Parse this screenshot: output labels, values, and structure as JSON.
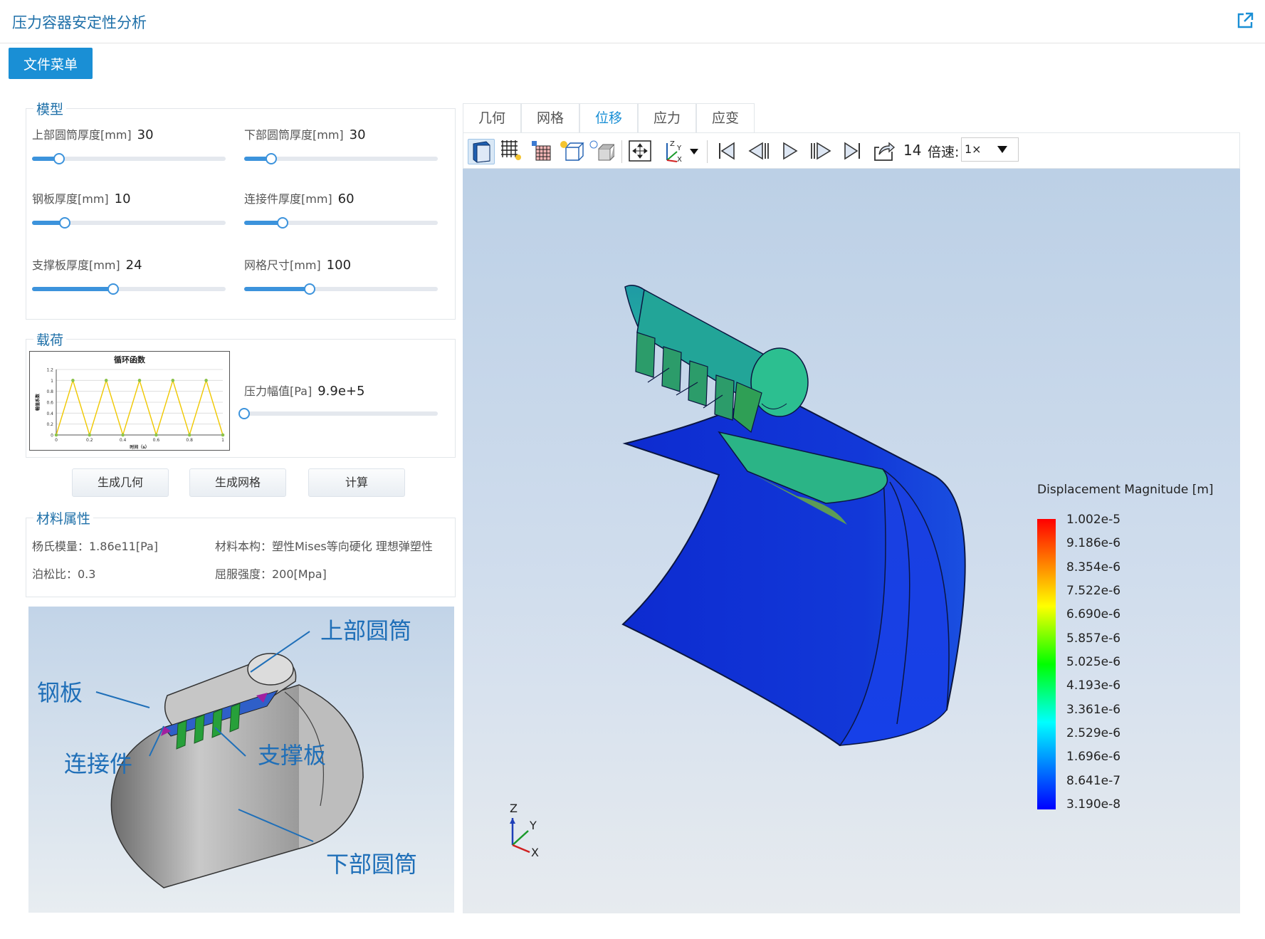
{
  "header": {
    "title": "压力容器安定性分析"
  },
  "menu_button": "文件菜单",
  "model": {
    "legend": "模型",
    "params": [
      {
        "label": "上部圆筒厚度[mm]",
        "value": "30",
        "fraction": 0.14
      },
      {
        "label": "下部圆筒厚度[mm]",
        "value": "30",
        "fraction": 0.14
      },
      {
        "label": "钢板厚度[mm]",
        "value": "10",
        "fraction": 0.17
      },
      {
        "label": "连接件厚度[mm]",
        "value": "60",
        "fraction": 0.2
      },
      {
        "label": "支撑板厚度[mm]",
        "value": "24",
        "fraction": 0.42
      },
      {
        "label": "网格尺寸[mm]",
        "value": "100",
        "fraction": 0.34
      }
    ]
  },
  "load": {
    "legend": "载荷",
    "chart_title": "循环函数",
    "chart_xlabel": "时间（s）",
    "chart_ylabel": "幅值系数",
    "x_ticks": [
      "0",
      "0.2",
      "0.4",
      "0.6",
      "0.8",
      "1"
    ],
    "y_ticks": [
      "0",
      "0.2",
      "0.4",
      "0.6",
      "0.8",
      "1",
      "1.2"
    ],
    "pressure_label": "压力幅值[Pa]",
    "pressure_value": "9.9e+5",
    "pressure_fraction": 0.0
  },
  "chart_data": {
    "type": "line",
    "title": "循环函数",
    "xlabel": "时间（s）",
    "ylabel": "幅值系数",
    "xlim": [
      0,
      1
    ],
    "ylim": [
      0,
      1.2
    ],
    "grid": true,
    "x": [
      0,
      0.1,
      0.2,
      0.3,
      0.4,
      0.5,
      0.6,
      0.7,
      0.8,
      0.9,
      1.0
    ],
    "series": [
      {
        "values": [
          0,
          1,
          0,
          1,
          0,
          1,
          0,
          1,
          0,
          1,
          0
        ]
      }
    ]
  },
  "actions": {
    "geometry": "生成几何",
    "mesh": "生成网格",
    "compute": "计算"
  },
  "material": {
    "legend": "材料属性",
    "youngs": "杨氏模量：1.86e11[Pa]",
    "constitutive": "材料本构：塑性Mises等向硬化 理想弹塑性",
    "poisson": "泊松比：0.3",
    "yield": "屈服强度：200[Mpa]"
  },
  "diagram": {
    "labels": {
      "upper": "上部圆筒",
      "plate": "钢板",
      "connector": "连接件",
      "support": "支撑板",
      "lower": "下部圆筒"
    }
  },
  "tabs": [
    {
      "label": "几何",
      "active": false
    },
    {
      "label": "网格",
      "active": false
    },
    {
      "label": "位移",
      "active": true
    },
    {
      "label": "应力",
      "active": false
    },
    {
      "label": "应变",
      "active": false
    }
  ],
  "toolbar": {
    "frame": "14",
    "speed_label": "倍速:",
    "speed_value": "1×",
    "icons": [
      "solid-view-icon",
      "mesh-view-icon",
      "mesh-solid-icon",
      "wireframe-icon",
      "light-icon",
      "fit-view-icon",
      "axis-orient-icon",
      "first-frame-icon",
      "prev-frame-icon",
      "play-icon",
      "next-frame-icon",
      "last-frame-icon",
      "export-icon"
    ]
  },
  "viewer": {
    "legend_title": "Displacement Magnitude [m]",
    "legend_values": [
      "1.002e-5",
      "9.186e-6",
      "8.354e-6",
      "7.522e-6",
      "6.690e-6",
      "5.857e-6",
      "5.025e-6",
      "4.193e-6",
      "3.361e-6",
      "2.529e-6",
      "1.696e-6",
      "8.641e-7",
      "3.190e-8"
    ],
    "axes": {
      "z": "Z",
      "y": "Y",
      "x": "X"
    }
  },
  "colors": {
    "accent": "#1a8fd5",
    "title": "#1d6fa8"
  }
}
